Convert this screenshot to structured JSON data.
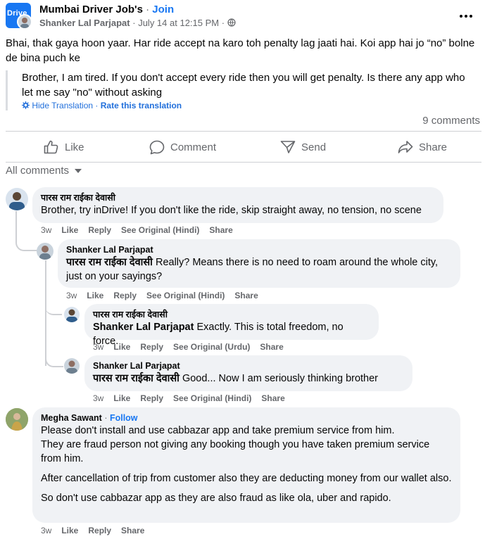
{
  "post": {
    "group_name": "Mumbai Driver Job's",
    "join_label": "Join",
    "author": "Shanker Lal Parjapat",
    "date": "July 14 at 12:15 PM",
    "group_logo_text": "Drive",
    "text": "Bhai, thak gaya hoon yaar. Har ride accept na karo toh penalty lag jaati hai. Koi app hai jo “no” bolne de bina puch ke",
    "translation": "Brother, I am tired. If you don't accept every ride then you will get penalty. Is there any app who let me say \"no\" without asking",
    "hide_translation": "Hide Translation",
    "rate_translation": "Rate this translation",
    "comments_count": "9 comments"
  },
  "actions": {
    "like": "Like",
    "comment": "Comment",
    "send": "Send",
    "share": "Share"
  },
  "filter_label": "All comments",
  "comments": [
    {
      "name": "पारस राम राईका देवासी",
      "text": "Brother, try inDrive! If you don't like the ride, skip straight away, no tension, no scene",
      "time": "3w",
      "like": "Like",
      "reply": "Reply",
      "see_original": "See Original (Hindi)",
      "share": "Share"
    },
    {
      "name": "Shanker Lal Parjapat",
      "tag": "पारस राम राईका देवासी",
      "text": " Really? Means there is no need to roam around the whole city, just on your sayings?",
      "time": "3w",
      "like": "Like",
      "reply": "Reply",
      "see_original": "See Original (Hindi)",
      "share": "Share"
    },
    {
      "name": "पारस राम राईका देवासी",
      "tag": "Shanker Lal Parjapat",
      "text": " Exactly. This is total freedom, no force.",
      "time": "3w",
      "like": "Like",
      "reply": "Reply",
      "see_original": "See Original (Urdu)",
      "share": "Share"
    },
    {
      "name": "Shanker Lal Parjapat",
      "tag": "पारस राम राईका देवासी",
      "text": " Good... Now I am seriously thinking brother",
      "time": "3w",
      "like": "Like",
      "reply": "Reply",
      "see_original": "See Original (Hindi)",
      "share": "Share"
    },
    {
      "name": "Megha Sawant",
      "follow": "Follow",
      "para1": "Please don't install and use cabbazar app and take premium service from him.",
      "para2": "They are fraud person not giving any booking though you have taken premium service from him.",
      "para3": "After cancellation of trip from customer also they are deducting money from our wallet also.",
      "para4": "So don't use cabbazar app as they are also fraud as like ola, uber and rapido.",
      "time": "3w",
      "like": "Like",
      "reply": "Reply",
      "share": "Share"
    }
  ]
}
